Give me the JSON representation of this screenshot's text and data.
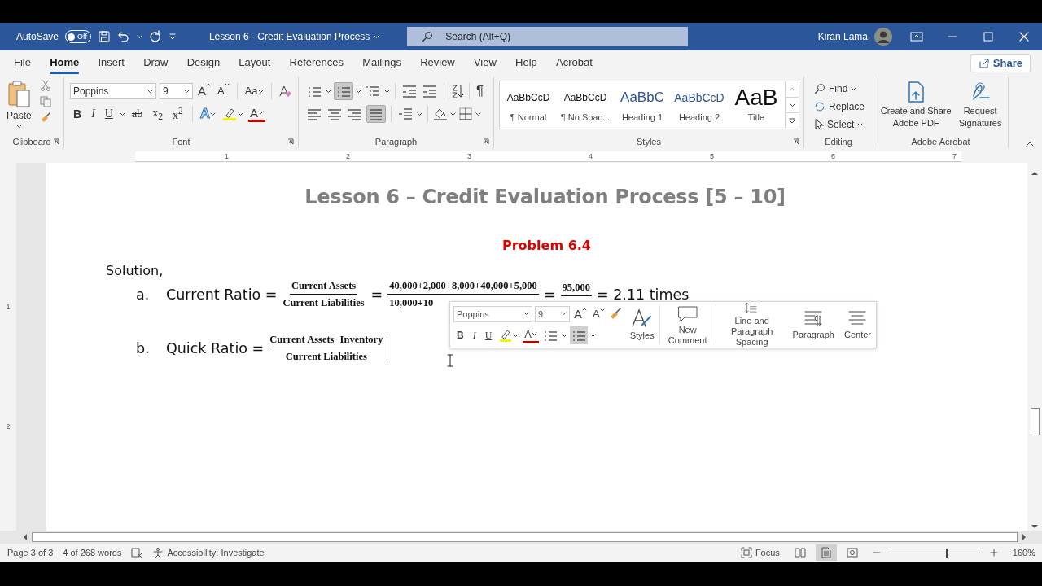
{
  "title_bar": {
    "autosave_label": "AutoSave",
    "autosave": {
      "label": "Off",
      "on": false
    },
    "document_title": "Lesson 6 - Credit Evaluation Process",
    "search_placeholder": "Search (Alt+Q)",
    "user_name": "Kiran Lama"
  },
  "tabs": [
    {
      "label": "File",
      "selected": false
    },
    {
      "label": "Home",
      "selected": true
    },
    {
      "label": "Insert",
      "selected": false
    },
    {
      "label": "Draw",
      "selected": false
    },
    {
      "label": "Design",
      "selected": false
    },
    {
      "label": "Layout",
      "selected": false
    },
    {
      "label": "References",
      "selected": false
    },
    {
      "label": "Mailings",
      "selected": false
    },
    {
      "label": "Review",
      "selected": false
    },
    {
      "label": "View",
      "selected": false
    },
    {
      "label": "Help",
      "selected": false
    },
    {
      "label": "Acrobat",
      "selected": false
    }
  ],
  "share_button": "Share",
  "ribbon": {
    "clipboard": {
      "paste": "Paste",
      "label": "Clipboard"
    },
    "font": {
      "font_name": "Poppins",
      "font_size": "9",
      "grow": "A",
      "shrink": "A",
      "change_case": "Aa",
      "format_buttons": [
        "B",
        "I",
        "U",
        "ab",
        "x$_{2}$",
        "x$^{2}$"
      ],
      "effects": "A",
      "font_color": "A",
      "label": "Font"
    },
    "paragraph": {
      "numbering_on": true,
      "justify_on": true,
      "pilcrow": "¶",
      "label": "Paragraph"
    },
    "styles": {
      "label": "Styles",
      "items": [
        {
          "preview": "AaBbCcD",
          "name": "¶ Normal",
          "kind": "normal"
        },
        {
          "preview": "AaBbCcD",
          "name": "¶ No Spac...",
          "kind": "normal"
        },
        {
          "preview": "AaBbC",
          "name": "Heading 1",
          "kind": "heading1"
        },
        {
          "preview": "AaBbCcD",
          "name": "Heading 2",
          "kind": "heading2"
        },
        {
          "preview": "AaB",
          "name": "Title",
          "kind": "title"
        }
      ]
    },
    "editing": {
      "items": [
        "Find",
        "Replace",
        "Select"
      ],
      "label": "Editing"
    },
    "adobe": {
      "items": [
        "Create and Share Adobe PDF",
        "Request Signatures"
      ],
      "label": "Adobe Acrobat"
    }
  },
  "ruler": {
    "labels": [
      "1",
      "2",
      "3",
      "4",
      "5",
      "6",
      "7"
    ],
    "vertical_labels": [
      "1",
      "2"
    ]
  },
  "document": {
    "heading": "Lesson 6 – Credit Evaluation Process [5 – 10]",
    "problem": "Problem 6.4",
    "solution": "Solution,",
    "items": [
      {
        "marker": "a.",
        "label": "Current Ratio =",
        "terms": [
          {
            "kind": "fraction",
            "numerator": "Current Assets",
            "denominator": "Current Liabilities"
          },
          {
            "kind": "text",
            "text": "="
          },
          {
            "kind": "fraction",
            "numerator": "40,000+2,000+8,000+40,000+5,000",
            "denominator": "10,000+10"
          },
          {
            "kind": "text",
            "text": "="
          },
          {
            "kind": "fraction",
            "numerator": "95,000"
          },
          {
            "kind": "text",
            "text": "= 2.11 times"
          }
        ]
      },
      {
        "marker": "b.",
        "label": "Quick Ratio =",
        "terms": [
          {
            "kind": "fraction",
            "numerator": "Current Assets−Inventory",
            "denominator": "Current Liabilities"
          }
        ]
      }
    ]
  },
  "mini_toolbar": {
    "font_name": "Poppins",
    "font_size": "9",
    "grow": "A",
    "shrink": "A",
    "format_buttons": [
      "B",
      "I",
      "U"
    ],
    "font_color": "A",
    "numbering_on": true,
    "buttons": [
      "Styles",
      "New Comment",
      "Line and Paragraph Spacing",
      "Paragraph",
      "Center"
    ]
  },
  "status_bar": {
    "page": "Page 3 of 3",
    "words": "4 of 268 words",
    "accessibility": "Accessibility: Investigate",
    "focus": "Focus",
    "views": [
      {
        "selected": false
      },
      {
        "selected": true
      },
      {
        "selected": false
      }
    ],
    "zoom": {
      "level": 0.63,
      "reading": "160%"
    }
  }
}
